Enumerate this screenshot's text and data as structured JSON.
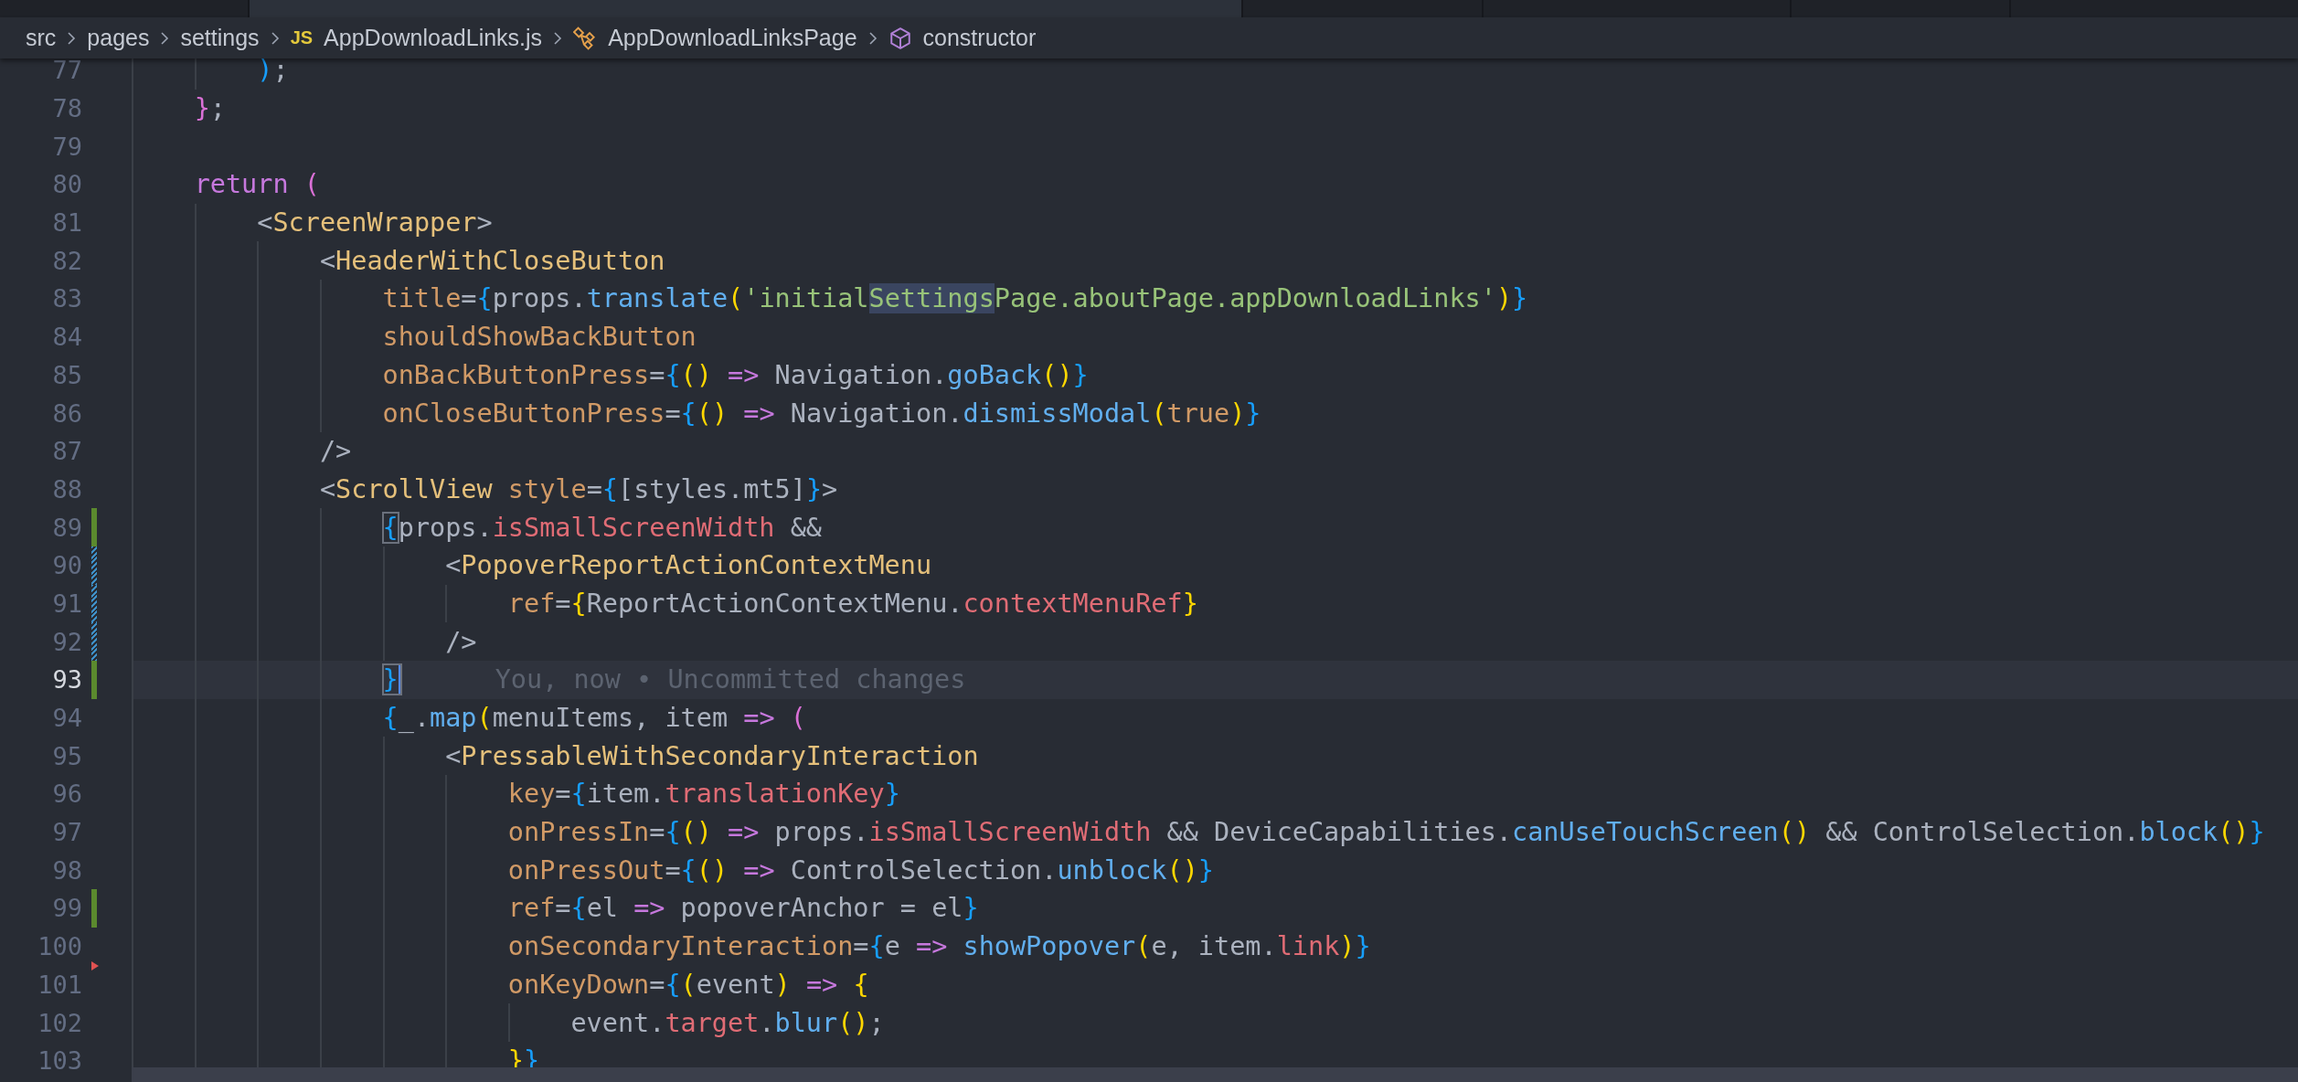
{
  "tabs": [
    {
      "selected": false
    },
    {
      "selected": true
    },
    {
      "selected": false
    },
    {
      "selected": false
    },
    {
      "selected": false
    },
    {
      "selected": false
    }
  ],
  "breadcrumb": [
    {
      "kind": "folder",
      "label": "src"
    },
    {
      "kind": "folder",
      "label": "pages"
    },
    {
      "kind": "folder",
      "label": "settings"
    },
    {
      "kind": "file",
      "badge": "JS",
      "label": "AppDownloadLinks.js"
    },
    {
      "kind": "class",
      "label": "AppDownloadLinksPage"
    },
    {
      "kind": "method",
      "label": "constructor"
    }
  ],
  "lines": [
    {
      "number": "77",
      "tokens": [
        {
          "text": "        )",
          "kind": "b3"
        },
        {
          "text": ";",
          "kind": "plain"
        }
      ]
    },
    {
      "number": "78",
      "tokens": [
        {
          "text": "    }",
          "kind": "b2"
        },
        {
          "text": ";",
          "kind": "plain"
        }
      ]
    },
    {
      "number": "79"
    },
    {
      "number": "80",
      "tokens": [
        {
          "text": "    return",
          "kind": "keyword"
        },
        {
          "text": " (",
          "kind": "b2"
        }
      ]
    },
    {
      "number": "81",
      "tokens": [
        {
          "text": "        <",
          "kind": "plain"
        },
        {
          "text": "ScreenWrapper",
          "kind": "tag"
        },
        {
          "text": ">",
          "kind": "plain"
        }
      ]
    },
    {
      "number": "82",
      "tokens": [
        {
          "text": "            <",
          "kind": "plain"
        },
        {
          "text": "HeaderWithCloseButton",
          "kind": "tag"
        }
      ]
    },
    {
      "number": "83",
      "tokens": [
        {
          "text": "                title",
          "kind": "attr"
        },
        {
          "text": "=",
          "kind": "plain"
        },
        {
          "text": "{",
          "kind": "b3"
        },
        {
          "text": "props.",
          "kind": "plain"
        },
        {
          "text": "translate",
          "kind": "fn"
        },
        {
          "text": "(",
          "kind": "b1"
        },
        {
          "text": "'initial",
          "kind": "string"
        },
        {
          "text": "Settings",
          "kind": "string",
          "highlighted": true
        },
        {
          "text": "Page.aboutPage.appDownloadLinks'",
          "kind": "string"
        },
        {
          "text": ")",
          "kind": "b1"
        },
        {
          "text": "}",
          "kind": "b3"
        }
      ]
    },
    {
      "number": "84",
      "tokens": [
        {
          "text": "                shouldShowBackButton",
          "kind": "attr"
        }
      ]
    },
    {
      "number": "85",
      "tokens": [
        {
          "text": "                onBackButtonPress",
          "kind": "attr"
        },
        {
          "text": "=",
          "kind": "plain"
        },
        {
          "text": "{",
          "kind": "b3"
        },
        {
          "text": "()",
          "kind": "b1"
        },
        {
          "text": " =>",
          "kind": "keyword"
        },
        {
          "text": " Navigation.",
          "kind": "plain"
        },
        {
          "text": "goBack",
          "kind": "fn"
        },
        {
          "text": "()",
          "kind": "b1"
        },
        {
          "text": "}",
          "kind": "b3"
        }
      ]
    },
    {
      "number": "86",
      "tokens": [
        {
          "text": "                onCloseButtonPress",
          "kind": "attr"
        },
        {
          "text": "=",
          "kind": "plain"
        },
        {
          "text": "{",
          "kind": "b3"
        },
        {
          "text": "()",
          "kind": "b1"
        },
        {
          "text": " =>",
          "kind": "keyword"
        },
        {
          "text": " Navigation.",
          "kind": "plain"
        },
        {
          "text": "dismissModal",
          "kind": "fn"
        },
        {
          "text": "(",
          "kind": "b1"
        },
        {
          "text": "true",
          "kind": "const"
        },
        {
          "text": ")",
          "kind": "b1"
        },
        {
          "text": "}",
          "kind": "b3"
        }
      ]
    },
    {
      "number": "87",
      "tokens": [
        {
          "text": "            />",
          "kind": "plain"
        }
      ]
    },
    {
      "number": "88",
      "tokens": [
        {
          "text": "            <",
          "kind": "plain"
        },
        {
          "text": "ScrollView",
          "kind": "tag"
        },
        {
          "text": " style",
          "kind": "attr"
        },
        {
          "text": "=",
          "kind": "plain"
        },
        {
          "text": "{",
          "kind": "b3"
        },
        {
          "text": "[styles.mt5]",
          "kind": "plain"
        },
        {
          "text": "}",
          "kind": "b3"
        },
        {
          "text": ">",
          "kind": "plain"
        }
      ]
    },
    {
      "number": "89",
      "added": true,
      "tokens": [
        {
          "text": "                {",
          "kind": "b3",
          "matched": true
        },
        {
          "text": "props.",
          "kind": "plain"
        },
        {
          "text": "isSmallScreenWidth",
          "kind": "prop"
        },
        {
          "text": " &&",
          "kind": "plain"
        }
      ]
    },
    {
      "number": "90",
      "modified": true,
      "tokens": [
        {
          "text": "                    <",
          "kind": "plain"
        },
        {
          "text": "PopoverReportActionContextMenu",
          "kind": "tag"
        }
      ]
    },
    {
      "number": "91",
      "modified": true,
      "tokens": [
        {
          "text": "                        ref",
          "kind": "attr"
        },
        {
          "text": "=",
          "kind": "plain"
        },
        {
          "text": "{",
          "kind": "b1"
        },
        {
          "text": "ReportActionContextMenu.",
          "kind": "plain"
        },
        {
          "text": "contextMenuRef",
          "kind": "prop"
        },
        {
          "text": "}",
          "kind": "b1"
        }
      ]
    },
    {
      "number": "92",
      "modified": true,
      "tokens": [
        {
          "text": "                    />",
          "kind": "plain"
        }
      ]
    },
    {
      "number": "93",
      "added": true,
      "current": true,
      "blame": "You, now • Uncommitted changes",
      "tokens": [
        {
          "text": "                }",
          "kind": "b3",
          "matched": true
        }
      ]
    },
    {
      "number": "94",
      "tokens": [
        {
          "text": "                {",
          "kind": "b3"
        },
        {
          "text": "_.",
          "kind": "plain"
        },
        {
          "text": "map",
          "kind": "fn"
        },
        {
          "text": "(",
          "kind": "b1"
        },
        {
          "text": "menuItems, item",
          "kind": "plain"
        },
        {
          "text": " =>",
          "kind": "keyword"
        },
        {
          "text": " (",
          "kind": "b2"
        }
      ]
    },
    {
      "number": "95",
      "tokens": [
        {
          "text": "                    <",
          "kind": "plain"
        },
        {
          "text": "PressableWithSecondaryInteraction",
          "kind": "tag"
        }
      ]
    },
    {
      "number": "96",
      "tokens": [
        {
          "text": "                        key",
          "kind": "attr"
        },
        {
          "text": "=",
          "kind": "plain"
        },
        {
          "text": "{",
          "kind": "b3"
        },
        {
          "text": "item.",
          "kind": "plain"
        },
        {
          "text": "translationKey",
          "kind": "prop"
        },
        {
          "text": "}",
          "kind": "b3"
        }
      ]
    },
    {
      "number": "97",
      "tokens": [
        {
          "text": "                        onPressIn",
          "kind": "attr"
        },
        {
          "text": "=",
          "kind": "plain"
        },
        {
          "text": "{",
          "kind": "b3"
        },
        {
          "text": "()",
          "kind": "b1"
        },
        {
          "text": " =>",
          "kind": "keyword"
        },
        {
          "text": " props.",
          "kind": "plain"
        },
        {
          "text": "isSmallScreenWidth",
          "kind": "prop"
        },
        {
          "text": " && DeviceCapabilities.",
          "kind": "plain"
        },
        {
          "text": "canUseTouchScreen",
          "kind": "fn"
        },
        {
          "text": "()",
          "kind": "b1"
        },
        {
          "text": " && ControlSelection.",
          "kind": "plain"
        },
        {
          "text": "block",
          "kind": "fn"
        },
        {
          "text": "()",
          "kind": "b1"
        },
        {
          "text": "}",
          "kind": "b3"
        }
      ]
    },
    {
      "number": "98",
      "tokens": [
        {
          "text": "                        onPressOut",
          "kind": "attr"
        },
        {
          "text": "=",
          "kind": "plain"
        },
        {
          "text": "{",
          "kind": "b3"
        },
        {
          "text": "()",
          "kind": "b1"
        },
        {
          "text": " =>",
          "kind": "keyword"
        },
        {
          "text": " ControlSelection.",
          "kind": "plain"
        },
        {
          "text": "unblock",
          "kind": "fn"
        },
        {
          "text": "()",
          "kind": "b1"
        },
        {
          "text": "}",
          "kind": "b3"
        }
      ]
    },
    {
      "number": "99",
      "added": true,
      "tokens": [
        {
          "text": "                        ref",
          "kind": "attr"
        },
        {
          "text": "=",
          "kind": "plain"
        },
        {
          "text": "{",
          "kind": "b3"
        },
        {
          "text": "el",
          "kind": "plain"
        },
        {
          "text": " =>",
          "kind": "keyword"
        },
        {
          "text": " popoverAnchor = el",
          "kind": "plain"
        },
        {
          "text": "}",
          "kind": "b3"
        }
      ]
    },
    {
      "number": "100",
      "tokens": [
        {
          "text": "                        onSecondaryInteraction",
          "kind": "attr"
        },
        {
          "text": "=",
          "kind": "plain"
        },
        {
          "text": "{",
          "kind": "b3"
        },
        {
          "text": "e",
          "kind": "plain"
        },
        {
          "text": " =>",
          "kind": "keyword"
        },
        {
          "text": " showPopover",
          "kind": "fn"
        },
        {
          "text": "(",
          "kind": "b1"
        },
        {
          "text": "e, item.",
          "kind": "plain"
        },
        {
          "text": "link",
          "kind": "prop"
        },
        {
          "text": ")",
          "kind": "b1"
        },
        {
          "text": "}",
          "kind": "b3"
        }
      ]
    },
    {
      "number": "101",
      "deleted": true,
      "tokens": [
        {
          "text": "                        onKeyDown",
          "kind": "attr"
        },
        {
          "text": "=",
          "kind": "plain"
        },
        {
          "text": "{",
          "kind": "b3"
        },
        {
          "text": "(",
          "kind": "b1"
        },
        {
          "text": "event",
          "kind": "plain"
        },
        {
          "text": ")",
          "kind": "b1"
        },
        {
          "text": " =>",
          "kind": "keyword"
        },
        {
          "text": " {",
          "kind": "b1"
        }
      ]
    },
    {
      "number": "102",
      "tokens": [
        {
          "text": "                            event.",
          "kind": "plain"
        },
        {
          "text": "target",
          "kind": "prop"
        },
        {
          "text": ".",
          "kind": "plain"
        },
        {
          "text": "blur",
          "kind": "fn"
        },
        {
          "text": "()",
          "kind": "b1"
        },
        {
          "text": ";",
          "kind": "plain"
        }
      ]
    },
    {
      "number": "103",
      "tokens": [
        {
          "text": "                        }",
          "kind": "b1"
        },
        {
          "text": "}",
          "kind": "b3"
        }
      ]
    }
  ]
}
